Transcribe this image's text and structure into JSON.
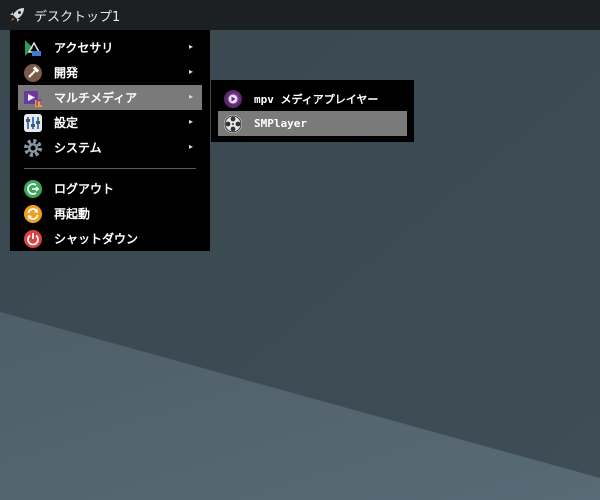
{
  "panel": {
    "launcher_icon": "rocket-icon",
    "title": "デスクトップ1"
  },
  "main_menu": {
    "items": [
      {
        "label": "アクセサリ",
        "icon": "accessories-icon",
        "submenu": true
      },
      {
        "label": "開発",
        "icon": "development-icon",
        "submenu": true
      },
      {
        "label": "マルチメディア",
        "icon": "multimedia-icon",
        "submenu": true,
        "selected": true
      },
      {
        "label": "設定",
        "icon": "settings-icon",
        "submenu": true
      },
      {
        "label": "システム",
        "icon": "system-gear-icon",
        "submenu": true
      },
      {
        "label": "ログアウト",
        "icon": "logout-icon",
        "submenu": false
      },
      {
        "label": "再起動",
        "icon": "reboot-icon",
        "submenu": false
      },
      {
        "label": "シャットダウン",
        "icon": "shutdown-icon",
        "submenu": false
      }
    ],
    "submenu_arrow": "▸"
  },
  "sub_menu": {
    "items": [
      {
        "label": "mpv メディアプレイヤー",
        "icon": "mpv-icon"
      },
      {
        "label": "SMPlayer",
        "icon": "smplayer-icon",
        "selected": true
      }
    ]
  },
  "colors": {
    "desktop_dark": "#36454e",
    "desktop_light": "#52626d",
    "panel": "#1c2023",
    "menu_bg": "#000000",
    "selection": "#7a7a7a"
  }
}
